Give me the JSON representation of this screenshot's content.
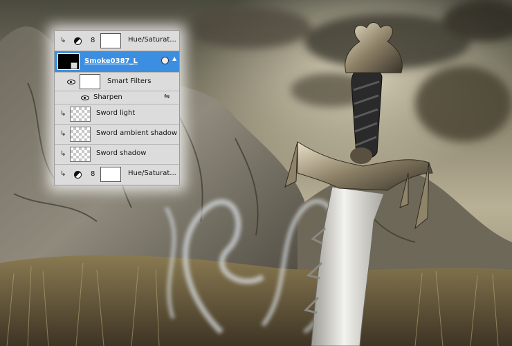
{
  "layers": {
    "hue_top": {
      "name": "Hue/Saturat..."
    },
    "smoke": {
      "name": "Smoke0387_L"
    },
    "smart_filters": {
      "label": "Smart Filters"
    },
    "sharpen": {
      "label": "Sharpen"
    },
    "sword_light": {
      "name": "Sword light"
    },
    "sword_ambient": {
      "name": "Sword ambient shadow"
    },
    "sword_shadow": {
      "name": "Sword shadow"
    },
    "hue_bottom": {
      "name": "Hue/Saturat..."
    }
  },
  "icons": {
    "clip": "↳",
    "chain": "8",
    "scroll_up": "▲",
    "filter_options": "⇋"
  },
  "colors": {
    "selected_layer": "#3c8fe0",
    "panel_bg": "#dcdcdc"
  }
}
